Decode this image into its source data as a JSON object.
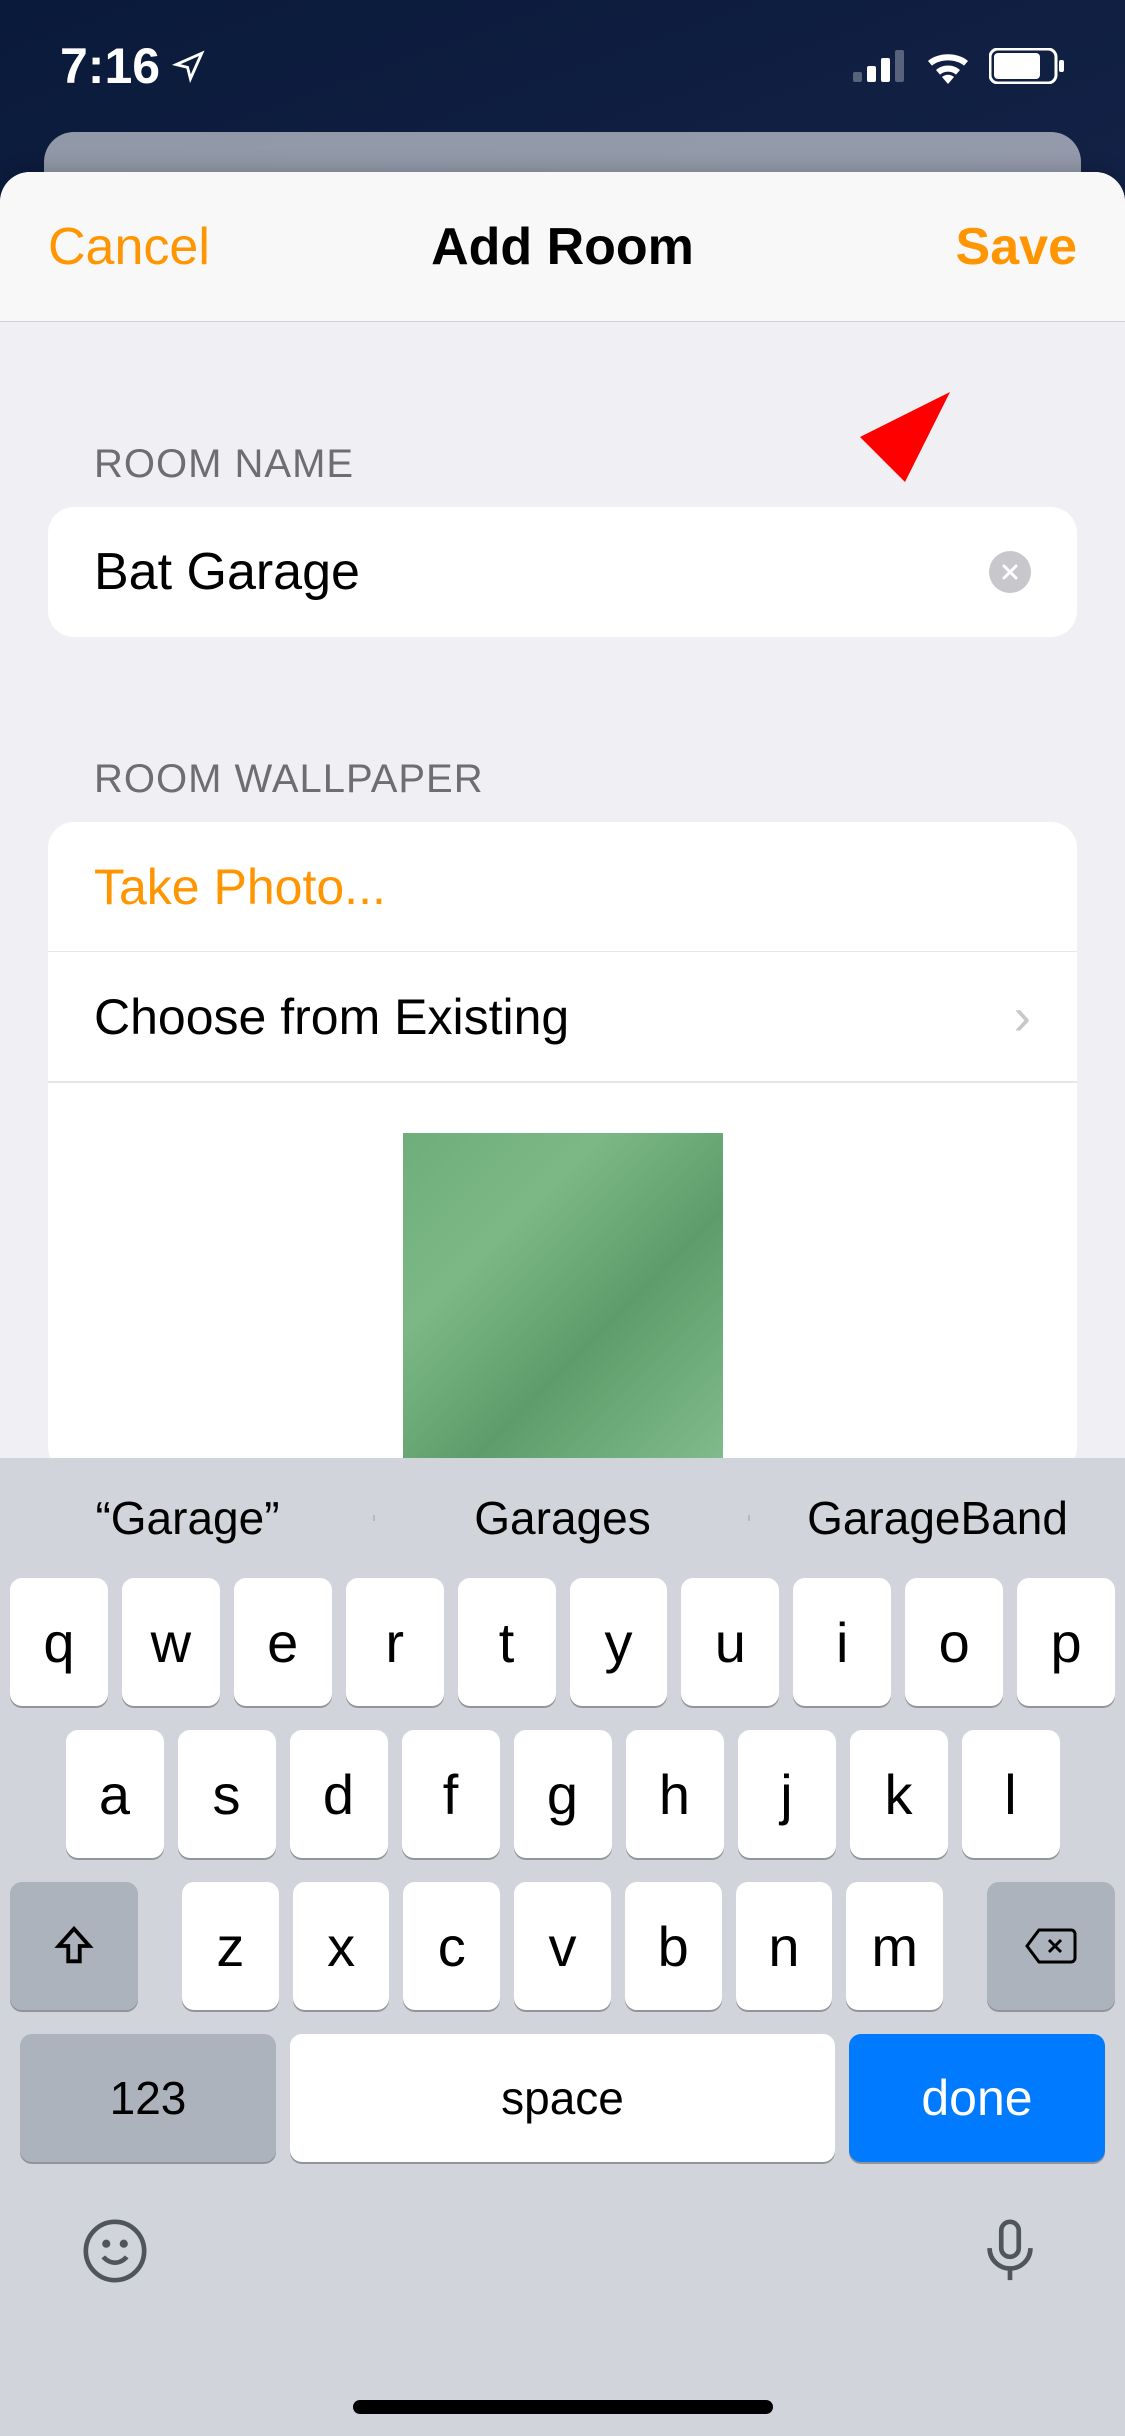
{
  "status_bar": {
    "time": "7:16"
  },
  "navbar": {
    "cancel": "Cancel",
    "title": "Add Room",
    "save": "Save"
  },
  "sections": {
    "room_name": {
      "header": "ROOM NAME",
      "value": "Bat Garage"
    },
    "wallpaper": {
      "header": "ROOM WALLPAPER",
      "take_photo": "Take Photo...",
      "choose_existing": "Choose from Existing"
    }
  },
  "keyboard": {
    "suggestions": [
      "“Garage”",
      "Garages",
      "GarageBand"
    ],
    "row1": [
      "q",
      "w",
      "e",
      "r",
      "t",
      "y",
      "u",
      "i",
      "o",
      "p"
    ],
    "row2": [
      "a",
      "s",
      "d",
      "f",
      "g",
      "h",
      "j",
      "k",
      "l"
    ],
    "row3": [
      "z",
      "x",
      "c",
      "v",
      "b",
      "n",
      "m"
    ],
    "numkey": "123",
    "space": "space",
    "done": "done"
  }
}
